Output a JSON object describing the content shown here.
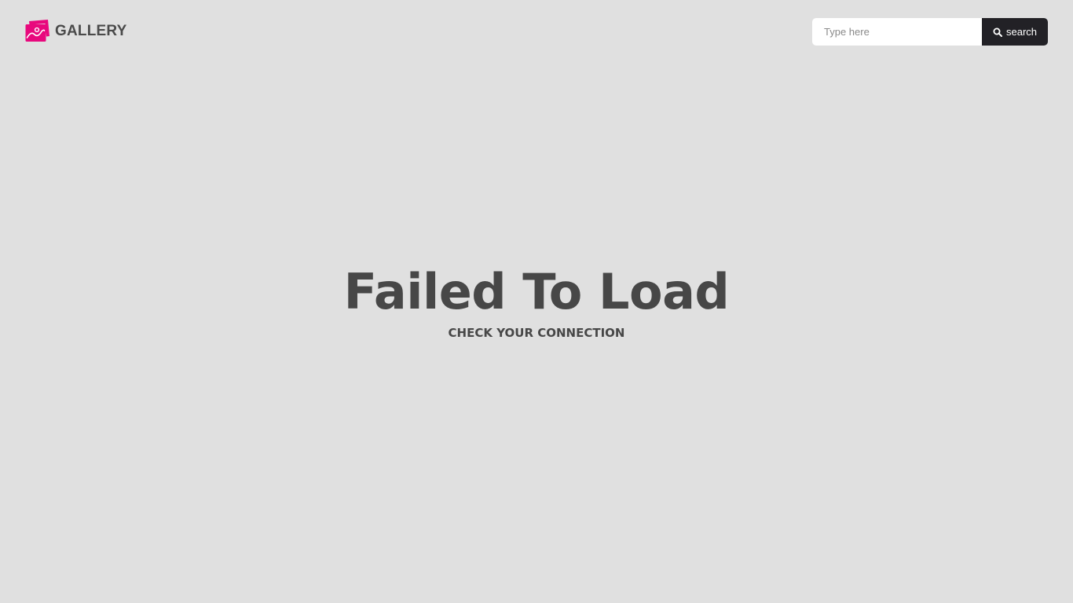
{
  "header": {
    "brand_name": "GALLERY",
    "logo_icon": "gallery-photos-icon",
    "accent_color": "#e8087d"
  },
  "search": {
    "placeholder": "Type here",
    "value": "",
    "button_label": "search",
    "button_icon": "search-icon"
  },
  "error": {
    "title": "Failed To Load",
    "subtitle": "CHECK YOUR CONNECTION"
  }
}
